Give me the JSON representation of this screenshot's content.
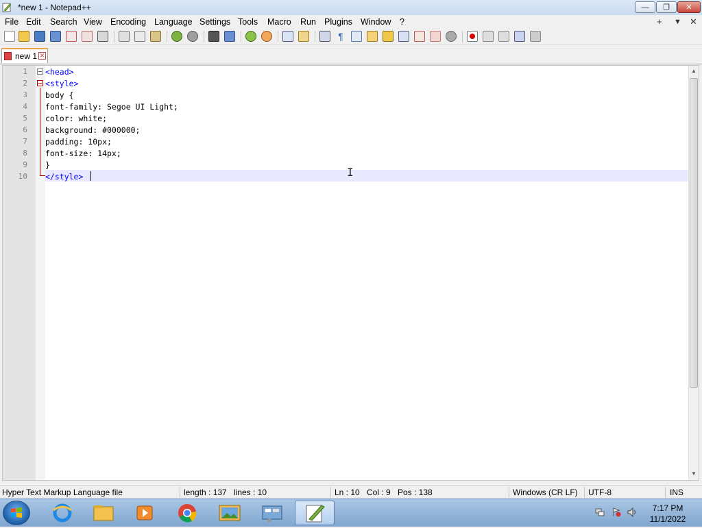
{
  "window": {
    "title": "*new 1 - Notepad++",
    "buttons": {
      "minimize": "—",
      "maximize": "❐",
      "close": "✕"
    }
  },
  "menu": {
    "items": [
      "File",
      "Edit",
      "Search",
      "View",
      "Encoding",
      "Language",
      "Settings",
      "Tools",
      "Macro",
      "Run",
      "Plugins",
      "Window",
      "?"
    ],
    "right_controls": [
      "+",
      "▼",
      "✕"
    ]
  },
  "tabs": [
    {
      "label": "new 1",
      "modified": true
    }
  ],
  "editor": {
    "lines": [
      {
        "number": "1",
        "text": "<head>"
      },
      {
        "number": "2",
        "text": "<style>"
      },
      {
        "number": "3",
        "text": "body {"
      },
      {
        "number": "4",
        "text": "font-family: Segoe UI Light;"
      },
      {
        "number": "5",
        "text": "color: white;"
      },
      {
        "number": "6",
        "text": "background: #000000;"
      },
      {
        "number": "7",
        "text": "padding: 10px;"
      },
      {
        "number": "8",
        "text": "font-size: 14px;"
      },
      {
        "number": "9",
        "text": "}"
      },
      {
        "number": "10",
        "text": "</style>"
      }
    ],
    "current_line": "10"
  },
  "status": {
    "file_type": "Hyper Text Markup Language file",
    "length": "length : 137",
    "lines": "lines : 10",
    "ln": "Ln : 10",
    "col": "Col : 9",
    "pos": "Pos : 138",
    "eol": "Windows (CR LF)",
    "encoding": "UTF-8",
    "mode": "INS"
  },
  "taskbar": {
    "time": "7:17 PM",
    "date": "11/1/2022"
  },
  "colors": {
    "tag": "#0000ff",
    "current_line_bg": "#e8e8ff",
    "fold_marker": "#c00000",
    "gutter": "#e4e4e4"
  }
}
